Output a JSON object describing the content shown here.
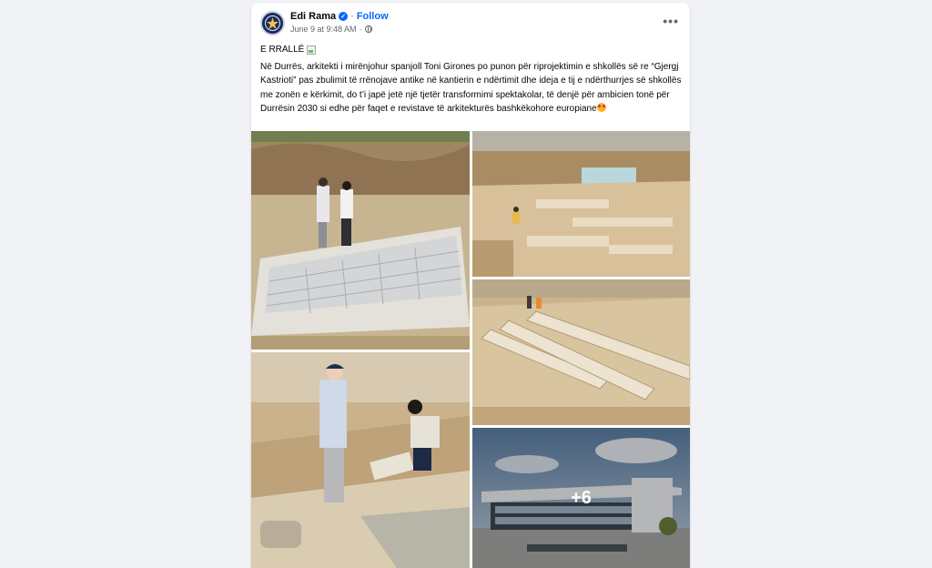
{
  "post": {
    "author": "Edi Rama",
    "follow_label": "Follow",
    "timestamp": "June 9 at 9:48 AM",
    "title": "E RRALLË",
    "body": "Në Durrës, arkitekti i mirënjohur spanjoll Toni Girones po punon për riprojektimin e shkollës së re “Gjergj Kastrioti” pas zbulimit të rrënojave antike në kantierin e ndërtimit dhe ideja e tij e ndërthurrjes së shkollës me zonën e kërkimit, do t’i japë jetë një tjetër transformimi spektakolar, të denjë për ambicien tonë për Durrësin 2030 si edhe për faqet e revistave të arkitekturës bashkëkohore europiane",
    "more_photos_label": "+6"
  },
  "icons": {
    "verified": "verified-badge-icon",
    "privacy": "globe-icon",
    "more": "more-options-icon",
    "title_image": "broken-image-icon",
    "emoji": "heart-eyes-emoji"
  },
  "colors": {
    "accent": "#0866ff",
    "background": "#f0f2f5",
    "secondary_text": "#65676b"
  }
}
